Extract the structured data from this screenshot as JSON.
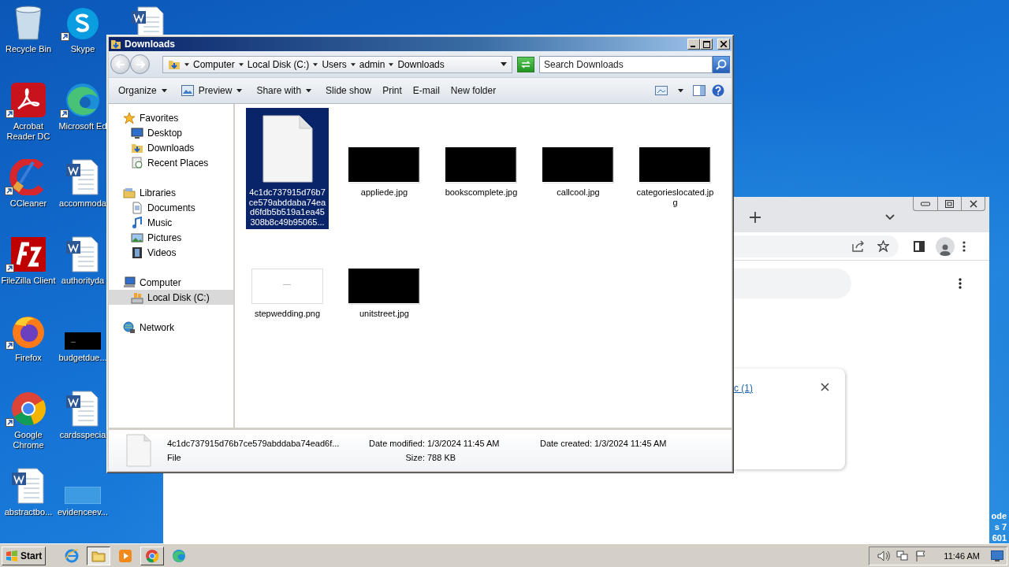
{
  "desktop_icons": [
    {
      "label": "Recycle Bin",
      "kind": "recycle",
      "shortcut": false
    },
    {
      "label": "Acrobat Reader DC",
      "kind": "acrobat",
      "shortcut": true
    },
    {
      "label": "CCleaner",
      "kind": "ccleaner",
      "shortcut": true
    },
    {
      "label": "FileZilla Client",
      "kind": "filezilla",
      "shortcut": true
    },
    {
      "label": "Firefox",
      "kind": "firefox",
      "shortcut": true
    },
    {
      "label": "Google Chrome",
      "kind": "chrome",
      "shortcut": true
    },
    {
      "label": "abstractbo...",
      "kind": "word",
      "shortcut": false
    },
    {
      "label": "Skype",
      "kind": "skype",
      "shortcut": true
    },
    {
      "label": "Microsoft Ed",
      "kind": "edge",
      "shortcut": true
    },
    {
      "label": "accommoda",
      "kind": "word",
      "shortcut": false
    },
    {
      "label": "authorityda",
      "kind": "word",
      "shortcut": false
    },
    {
      "label": "budgetdue...",
      "kind": "dark",
      "shortcut": false
    },
    {
      "label": "cardsspecia",
      "kind": "word",
      "shortcut": false
    },
    {
      "label": "evidenceev...",
      "kind": "blank",
      "shortcut": false
    },
    {
      "kind": "word"
    }
  ],
  "desktop_watermark": [
    "ode",
    "s 7",
    "601"
  ],
  "browser": {
    "download_link": "c (1)"
  },
  "explorer": {
    "title": "Downloads",
    "breadcrumb": [
      "Computer",
      "Local Disk (C:)",
      "Users",
      "admin",
      "Downloads"
    ],
    "search": {
      "placeholder": "Search Downloads"
    },
    "toolbar": [
      {
        "label": "Organize",
        "kind": "text",
        "dropdown": true
      },
      {
        "label": "Preview",
        "kind": "preview",
        "dropdown": true
      },
      {
        "label": "Share with",
        "kind": "text",
        "dropdown": true
      },
      {
        "label": "Slide show",
        "kind": "text",
        "dropdown": false
      },
      {
        "label": "Print",
        "kind": "text",
        "dropdown": false
      },
      {
        "label": "E-mail",
        "kind": "text",
        "dropdown": false
      },
      {
        "label": "New folder",
        "kind": "text",
        "dropdown": false
      }
    ],
    "nav": [
      {
        "label": "Favorites",
        "kind": "star",
        "selected": false,
        "children": [
          {
            "label": "Desktop",
            "kind": "desktop",
            "selected": false
          },
          {
            "label": "Downloads",
            "kind": "downloads",
            "selected": false
          },
          {
            "label": "Recent Places",
            "kind": "recent",
            "selected": false
          }
        ]
      },
      {
        "label": "Libraries",
        "kind": "libraries",
        "selected": false,
        "children": [
          {
            "label": "Documents",
            "kind": "documents",
            "selected": false
          },
          {
            "label": "Music",
            "kind": "music",
            "selected": false
          },
          {
            "label": "Pictures",
            "kind": "pictures",
            "selected": false
          },
          {
            "label": "Videos",
            "kind": "videos",
            "selected": false
          }
        ]
      },
      {
        "label": "Computer",
        "kind": "computer",
        "selected": false,
        "children": [
          {
            "label": "Local Disk (C:)",
            "kind": "disk",
            "selected": true
          }
        ]
      },
      {
        "label": "Network",
        "kind": "network",
        "selected": false
      }
    ],
    "files": [
      {
        "name": "4c1dc737915d76b7ce579abddaba74ead6fdb5b519a1ea45308b8c49b95065...",
        "kind": "file",
        "selected": true
      },
      {
        "name": "appliede.jpg",
        "kind": "dark",
        "selected": false
      },
      {
        "name": "bookscomplete.jpg",
        "kind": "dark",
        "selected": false
      },
      {
        "name": "callcool.jpg",
        "kind": "dark",
        "selected": false
      },
      {
        "name": "categorieslocated.jpg",
        "kind": "dark",
        "selected": false
      },
      {
        "name": "stepwedding.png",
        "kind": "light",
        "selected": false
      },
      {
        "name": "unitstreet.jpg",
        "kind": "dark",
        "selected": false
      }
    ],
    "details": {
      "name": "4c1dc737915d76b7ce579abddaba74ead6f...",
      "type": "File",
      "modified_label": "Date modified:",
      "modified": "1/3/2024 11:45 AM",
      "size_label": "Size:",
      "size": "788 KB",
      "created_label": "Date created:",
      "created": "1/3/2024 11:45 AM"
    }
  },
  "taskbar": {
    "start": "Start",
    "apps": [
      {
        "kind": "ie",
        "selected": false,
        "open": false
      },
      {
        "kind": "explorer",
        "selected": true,
        "open": true
      },
      {
        "kind": "media",
        "selected": false,
        "open": false
      },
      {
        "kind": "chrome",
        "selected": false,
        "open": true
      },
      {
        "kind": "edge",
        "selected": false,
        "open": false
      }
    ],
    "clock": "11:46 AM"
  }
}
